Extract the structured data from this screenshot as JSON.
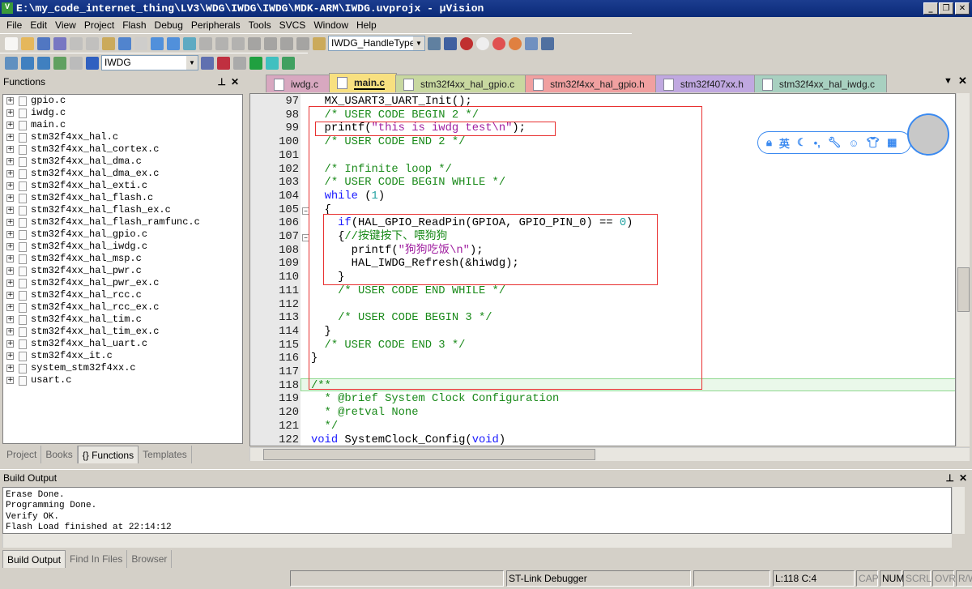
{
  "window": {
    "title": "E:\\my_code_internet_thing\\LV3\\WDG\\IWDG\\IWDG\\MDK-ARM\\IWDG.uvprojx - µVision",
    "controls": [
      "_",
      "❐",
      "✕"
    ]
  },
  "menu": [
    "File",
    "Edit",
    "View",
    "Project",
    "Flash",
    "Debug",
    "Peripherals",
    "Tools",
    "SVCS",
    "Window",
    "Help"
  ],
  "toolbar": {
    "find_combo": "IWDG_HandleTypeD",
    "target_combo": "IWDG"
  },
  "functions_panel": {
    "title": "Functions",
    "pin": "ᵠ",
    "close": "✕",
    "files": [
      "gpio.c",
      "iwdg.c",
      "main.c",
      "stm32f4xx_hal.c",
      "stm32f4xx_hal_cortex.c",
      "stm32f4xx_hal_dma.c",
      "stm32f4xx_hal_dma_ex.c",
      "stm32f4xx_hal_exti.c",
      "stm32f4xx_hal_flash.c",
      "stm32f4xx_hal_flash_ex.c",
      "stm32f4xx_hal_flash_ramfunc.c",
      "stm32f4xx_hal_gpio.c",
      "stm32f4xx_hal_iwdg.c",
      "stm32f4xx_hal_msp.c",
      "stm32f4xx_hal_pwr.c",
      "stm32f4xx_hal_pwr_ex.c",
      "stm32f4xx_hal_rcc.c",
      "stm32f4xx_hal_rcc_ex.c",
      "stm32f4xx_hal_tim.c",
      "stm32f4xx_hal_tim_ex.c",
      "stm32f4xx_hal_uart.c",
      "stm32f4xx_it.c",
      "system_stm32f4xx.c",
      "usart.c"
    ],
    "tabs": [
      {
        "label": "Project",
        "active": false
      },
      {
        "label": "Books",
        "active": false
      },
      {
        "label": "{} Functions",
        "active": true
      },
      {
        "label": "Templates",
        "active": false
      }
    ]
  },
  "editor": {
    "tabs": [
      {
        "label": "iwdg.c",
        "color": "#d8a8c0",
        "active": false
      },
      {
        "label": "main.c",
        "color": "#f8e080",
        "active": true
      },
      {
        "label": "stm32f4xx_hal_gpio.c",
        "color": "#c8d8a0",
        "active": false
      },
      {
        "label": "stm32f4xx_hal_gpio.h",
        "color": "#f0a0a0",
        "active": false
      },
      {
        "label": "stm32f407xx.h",
        "color": "#c0a8e0",
        "active": false
      },
      {
        "label": "stm32f4xx_hal_iwdg.c",
        "color": "#a8d0c0",
        "active": false
      }
    ],
    "current_line": 118,
    "lines": [
      {
        "n": "97",
        "seg": [
          [
            "  MX_USART3_UART_Init();",
            ""
          ]
        ]
      },
      {
        "n": "98",
        "seg": [
          [
            "  /* USER CODE BEGIN 2 */",
            "c"
          ]
        ]
      },
      {
        "n": "99",
        "seg": [
          [
            "  printf(",
            ""
          ],
          [
            "\"this is iwdg test\\n\"",
            "s"
          ],
          [
            ");",
            ""
          ]
        ]
      },
      {
        "n": "100",
        "seg": [
          [
            "  /* USER CODE END 2 */",
            "c"
          ]
        ]
      },
      {
        "n": "101",
        "seg": []
      },
      {
        "n": "102",
        "seg": [
          [
            "  /* Infinite loop */",
            "c"
          ]
        ]
      },
      {
        "n": "103",
        "seg": [
          [
            "  /* USER CODE BEGIN WHILE */",
            "c"
          ]
        ]
      },
      {
        "n": "104",
        "seg": [
          [
            "  ",
            ""
          ],
          [
            "while",
            "k"
          ],
          [
            " (",
            ""
          ],
          [
            "1",
            "num"
          ],
          [
            ")",
            ""
          ]
        ]
      },
      {
        "n": "105",
        "seg": [
          [
            "  {",
            ""
          ]
        ],
        "fold": true
      },
      {
        "n": "106",
        "seg": [
          [
            "    ",
            ""
          ],
          [
            "if",
            "k"
          ],
          [
            "(HAL_GPIO_ReadPin(GPIOA, GPIO_PIN_0) == ",
            ""
          ],
          [
            "0",
            "num"
          ],
          [
            ")",
            ""
          ]
        ]
      },
      {
        "n": "107",
        "seg": [
          [
            "    {",
            ""
          ],
          [
            "//按键按下、喂狗狗",
            "c"
          ]
        ],
        "fold": true
      },
      {
        "n": "108",
        "seg": [
          [
            "      printf(",
            ""
          ],
          [
            "\"狗狗吃饭\\n\"",
            "s"
          ],
          [
            ");",
            ""
          ]
        ]
      },
      {
        "n": "109",
        "seg": [
          [
            "      HAL_IWDG_Refresh(&hiwdg);",
            ""
          ]
        ]
      },
      {
        "n": "110",
        "seg": [
          [
            "    }",
            ""
          ]
        ]
      },
      {
        "n": "111",
        "seg": [
          [
            "    /* USER CODE END WHILE */",
            "c"
          ]
        ]
      },
      {
        "n": "112",
        "seg": []
      },
      {
        "n": "113",
        "seg": [
          [
            "    /* USER CODE BEGIN 3 */",
            "c"
          ]
        ]
      },
      {
        "n": "114",
        "seg": [
          [
            "  }",
            ""
          ]
        ]
      },
      {
        "n": "115",
        "seg": [
          [
            "  /* USER CODE END 3 */",
            "c"
          ]
        ]
      },
      {
        "n": "116",
        "seg": [
          [
            "}",
            ""
          ]
        ]
      },
      {
        "n": "117",
        "seg": []
      },
      {
        "n": "118",
        "seg": [
          [
            "/**",
            "c"
          ]
        ],
        "fold": true
      },
      {
        "n": "119",
        "seg": [
          [
            "  * @brief System Clock Configuration",
            "c"
          ]
        ]
      },
      {
        "n": "120",
        "seg": [
          [
            "  * @retval None",
            "c"
          ]
        ]
      },
      {
        "n": "121",
        "seg": [
          [
            "  */",
            "c"
          ]
        ]
      },
      {
        "n": "122",
        "seg": [
          [
            "void",
            "k"
          ],
          [
            " SystemClock_Config(",
            ""
          ],
          [
            "void",
            "k"
          ],
          [
            ")",
            ""
          ]
        ]
      }
    ]
  },
  "ime_toolbar": {
    "items": [
      "lock-icon",
      "英",
      "moon-icon",
      "punctuation-icon",
      "wrench-icon",
      "smiley-icon",
      "shirt-icon",
      "grid-icon"
    ]
  },
  "build_output": {
    "title": "Build Output",
    "lines": [
      "Erase Done.",
      "Programming Done.",
      "Verify OK.",
      "Flash Load finished at 22:14:12"
    ],
    "tabs": [
      {
        "label": "Build Output",
        "active": true
      },
      {
        "label": "Find In Files",
        "active": false
      },
      {
        "label": "Browser",
        "active": false
      }
    ]
  },
  "status": {
    "debugger": "ST-Link Debugger",
    "position": "L:118 C:4",
    "indicators": [
      "CAP",
      "NUM",
      "SCRL",
      "OVR",
      "R/W"
    ],
    "active_indicator": "NUM"
  }
}
